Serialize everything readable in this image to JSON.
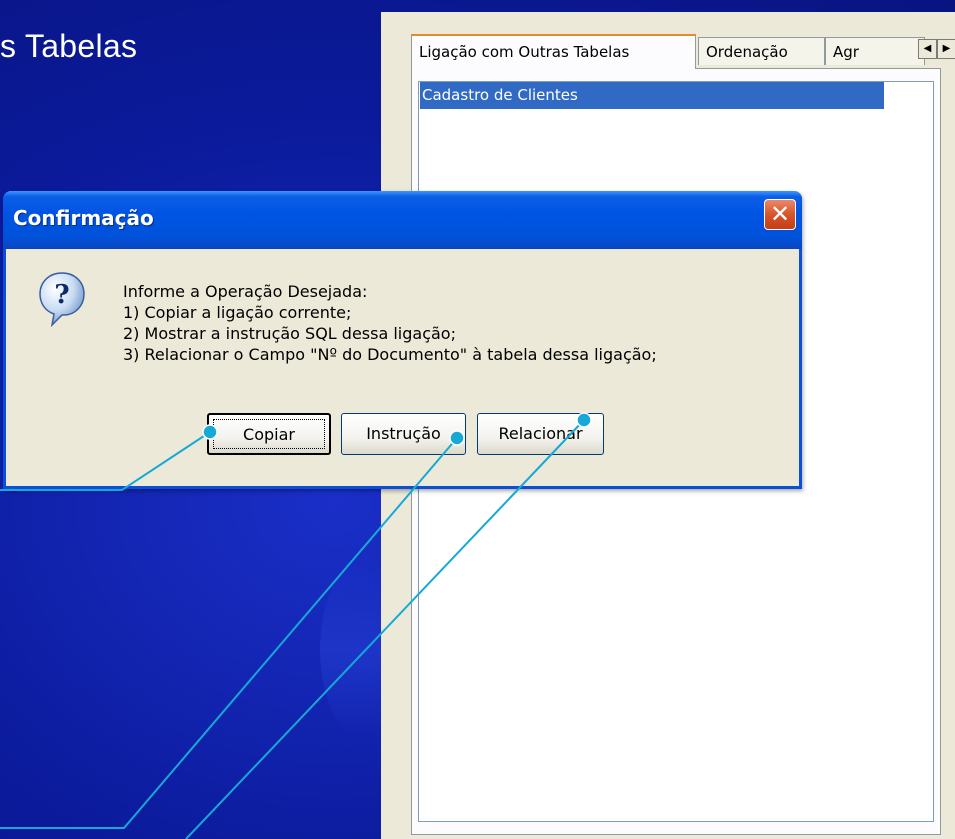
{
  "slide": {
    "title": "s Tabelas"
  },
  "panel": {
    "tabs": [
      {
        "label": "Ligação com Outras Tabelas",
        "active": true
      },
      {
        "label": "Ordenação",
        "active": false
      },
      {
        "label": "Agr",
        "active": false
      }
    ],
    "scroll_left_icon": "◀",
    "scroll_right_icon": "▶",
    "list_items": [
      {
        "label": "Cadastro de Clientes",
        "selected": true
      }
    ]
  },
  "dialog": {
    "title": "Confirmação",
    "close_glyph": "✕",
    "icon": "question-icon",
    "message_lines": [
      "Informe a Operação Desejada:",
      "1) Copiar a ligação corrente;",
      "2) Mostrar a instrução SQL dessa ligação;",
      "3) Relacionar o Campo \"Nº do Documento\" à tabela dessa ligação;"
    ],
    "buttons": {
      "copy": "Copiar",
      "instruction": "Instrução",
      "relate": "Relacionar"
    }
  },
  "colors": {
    "slide_background": "#0b1a9a",
    "titlebar": "#0054e3",
    "callout_line": "#17a9d6",
    "selection": "#316ac5"
  }
}
